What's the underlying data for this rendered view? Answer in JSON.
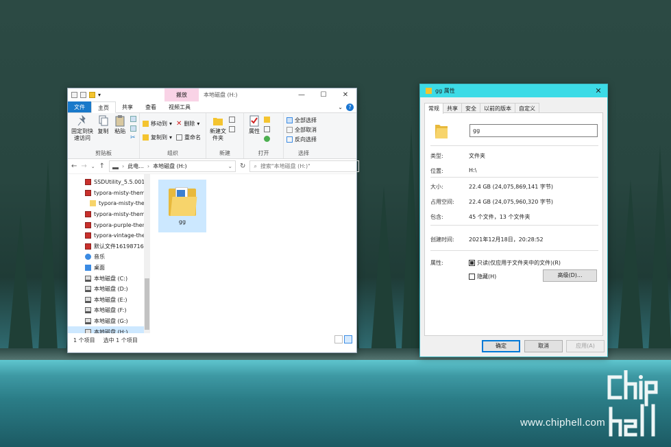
{
  "explorer": {
    "context_tab": "搬放",
    "title": "本地磁盘 (H:)",
    "tabs": [
      "文件",
      "主页",
      "共享",
      "查看",
      "视频工具"
    ],
    "ribbon": {
      "clipboard": {
        "label": "剪贴板",
        "pin": "固定到快速访问",
        "copy": "复制",
        "paste": "粘贴"
      },
      "organize": {
        "label": "组织",
        "move_to": "移动到",
        "copy_to": "复制到",
        "delete": "删除",
        "rename": "重命名"
      },
      "new": {
        "label": "新建",
        "new_folder": "新建文件夹"
      },
      "open": {
        "label": "打开",
        "properties": "属性"
      },
      "select": {
        "label": "选择",
        "select_all": "全部选择",
        "select_none": "全部取消",
        "invert": "反向选择"
      }
    },
    "address": {
      "crumb1": "此电...",
      "crumb2": "本地磁盘 (H:)",
      "search_placeholder": "搜索\"本地磁盘 (H:)\""
    },
    "tree": [
      {
        "label": "SSDUtility_5.5.0013_",
        "icon": "zip-icon"
      },
      {
        "label": "typora-misty-theme",
        "icon": "zip-icon"
      },
      {
        "label": "typora-misty-then",
        "icon": "folder-icon"
      },
      {
        "label": "typora-misty-theme",
        "icon": "zip-icon"
      },
      {
        "label": "typora-purple-then",
        "icon": "zip-icon"
      },
      {
        "label": "typora-vintage-ther",
        "icon": "zip-icon"
      },
      {
        "label": "默认文件161987160",
        "icon": "zip-icon"
      },
      {
        "label": "音乐",
        "icon": "music-icon"
      },
      {
        "label": "桌面",
        "icon": "desktop-icon"
      },
      {
        "label": "本地磁盘 (C:)",
        "icon": "drive-icon"
      },
      {
        "label": "本地磁盘 (D:)",
        "icon": "drive-icon"
      },
      {
        "label": "本地磁盘 (E:)",
        "icon": "drive-icon"
      },
      {
        "label": "本地磁盘 (F:)",
        "icon": "drive-icon"
      },
      {
        "label": "本地磁盘 (G:)",
        "icon": "drive-icon"
      },
      {
        "label": "本地磁盘 (H:)",
        "icon": "drive-icon",
        "selected": true
      }
    ],
    "folder_item": "gg",
    "status": {
      "count": "1 个项目",
      "selected": "选中 1 个项目"
    }
  },
  "dialog": {
    "title": "gg 属性",
    "tabs": [
      "常规",
      "共享",
      "安全",
      "以前的版本",
      "自定义"
    ],
    "name": "gg",
    "type_label": "类型:",
    "type_value": "文件夹",
    "location_label": "位置:",
    "location_value": "H:\\",
    "size_label": "大小:",
    "size_value": "22.4 GB (24,075,869,141 字节)",
    "disk_label": "占用空间:",
    "disk_value": "22.4 GB (24,075,960,320 字节)",
    "contains_label": "包含:",
    "contains_value": "45 个文件，13 个文件夹",
    "created_label": "创建时间:",
    "created_value": "2021年12月18日，20:28:52",
    "attr_label": "属性:",
    "readonly": "只读(仅应用于文件夹中的文件)(R)",
    "hidden": "隐藏(H)",
    "advanced": "高级(D)...",
    "ok": "确定",
    "cancel": "取消",
    "apply": "应用(A)"
  },
  "watermark": "www.chiphell.com",
  "colors": {
    "accent": "#1979ca",
    "dialog_title": "#3cdbe6",
    "selection": "#cce8ff",
    "folder": "#f7d46b"
  }
}
